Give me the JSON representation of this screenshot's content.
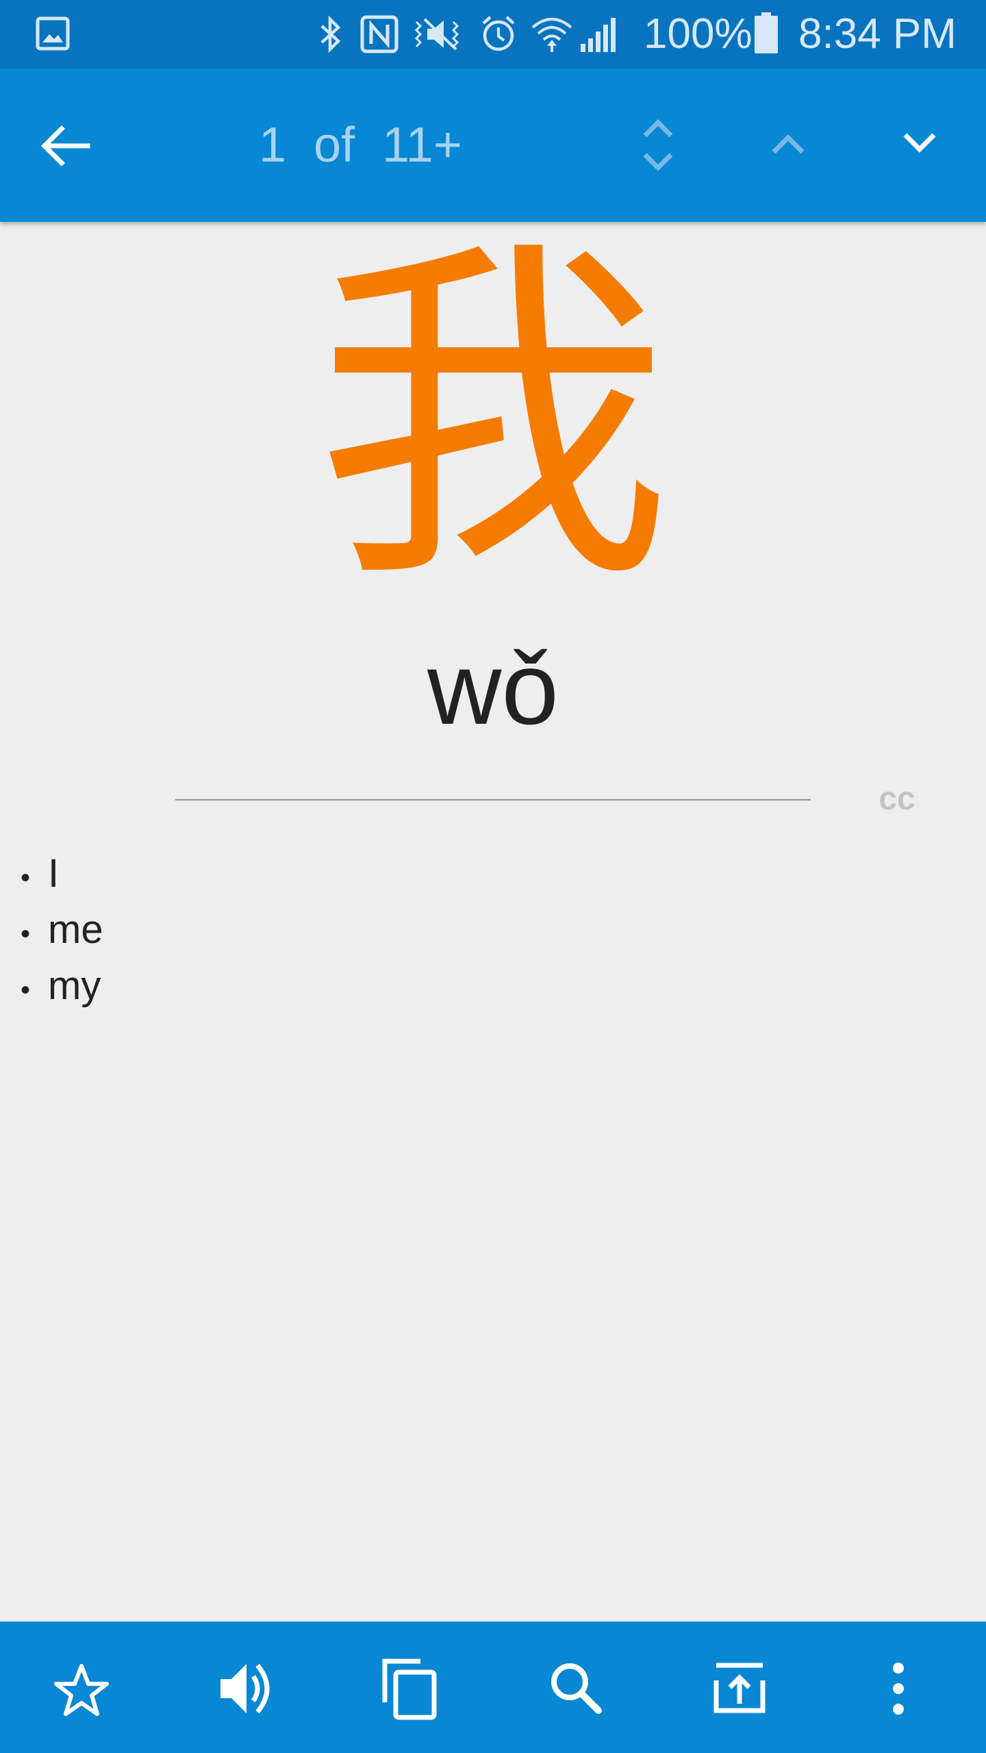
{
  "status_bar": {
    "battery_text": "100%",
    "time": "8:34 PM",
    "icons": [
      "gallery-notification-icon",
      "bluetooth-icon",
      "nfc-icon",
      "vibrate-icon",
      "alarm-icon",
      "wifi-icon",
      "signal-icon",
      "battery-icon"
    ]
  },
  "toolbar": {
    "back_icon": "arrow-left-icon",
    "match_counter": "1  of  11+",
    "expand_icon": "unfold-icon",
    "prev_icon": "chevron-up-icon",
    "next_icon": "chevron-down-icon"
  },
  "entry": {
    "headword": "我",
    "pinyin": "wǒ",
    "source_badge": "cc",
    "definitions": [
      {
        "bullet": "•",
        "text": "I"
      },
      {
        "bullet": "•",
        "text": "me"
      },
      {
        "bullet": "•",
        "text": "my"
      }
    ]
  },
  "bottom_bar": {
    "icons": [
      "star-icon",
      "speaker-icon",
      "copy-icon",
      "search-icon",
      "share-icon",
      "more-vert-icon"
    ]
  },
  "colors": {
    "status_bar": "#0874bf",
    "app_bar": "#0787d4",
    "headword": "#f57c00",
    "background": "#eeeeef"
  }
}
